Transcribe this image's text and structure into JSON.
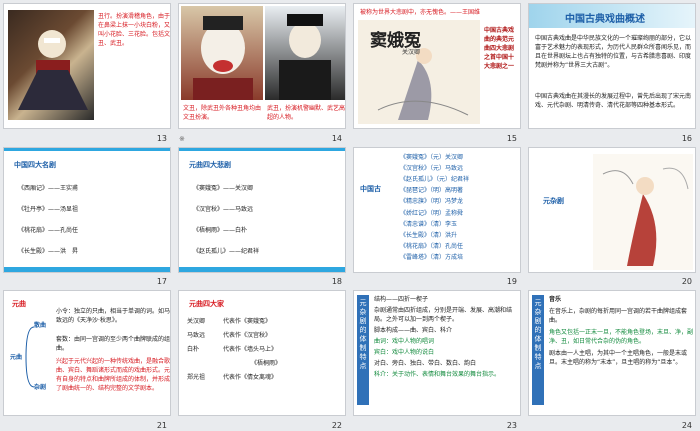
{
  "slides": [
    {
      "number": "13",
      "caption": "丑行。扮演滑稽角色，由于在鼻梁上抹一小块白粉，又叫小花脸、三花脸。包括文丑、武丑。"
    },
    {
      "number": "14",
      "transition_icon": "※",
      "caption_left": "文丑，除武丑外各种丑角均由文丑扮演。",
      "caption_right": "武丑，扮演机警幽默、武艺高超的人物。"
    },
    {
      "number": "15",
      "top_line": "被称为世界大悲剧中，亦无愧色。——王国维",
      "title": "窦娥冤",
      "subtitle": "关汉卿",
      "side_text": "中国古典戏曲的典范元曲四大悲剧之首中国十大悲剧之一"
    },
    {
      "number": "16",
      "title": "中国古典戏曲概述",
      "para1": "中国古典戏曲是中华民族文化的一个璀璨绚丽的部分，它以富于艺术魅力的表现形式，为历代人民群众所喜闻乐见，而且在世界剧坛上也占有独特的位置，与古希腊悲喜剧、印度梵剧并称为“世界三大古剧”。",
      "para2": "中国古典戏曲在其漫长的发展过程中，曾先后出现了宋元南戏、元代杂剧、明清传奇、清代花部等四种基本形式。"
    },
    {
      "number": "17",
      "heading": "中国四大名剧",
      "items": [
        "《西厢记》——王实甫",
        "《牡丹亭》——汤显祖",
        "《桃花扇》——孔尚任",
        "《长生殿》——洪　昇"
      ]
    },
    {
      "number": "18",
      "heading": "元曲四大悲剧",
      "items": [
        "《窦娥冤》——关汉卿",
        "《汉宫秋》——马致远",
        "《梧桐雨》——白朴",
        "《赵氏孤儿》——纪君祥"
      ]
    },
    {
      "number": "19",
      "side_label": "中国古",
      "items": [
        "《窦娥冤》（元）关汉卿",
        "《汉宫秋》（元）马致远",
        "《赵氏孤儿》（元）纪君祥",
        "《琵琶记》（明）高明著",
        "《精忠旗》（明）冯梦龙",
        "《娇红记》（明）孟称舜",
        "《清忠谱》（清）李玉",
        "《长生殿》（清）洪升",
        "《桃花扇》（清）孔尚任",
        "《雷峰塔》（清）方成培"
      ]
    },
    {
      "number": "20",
      "label": "元杂剧"
    },
    {
      "number": "21",
      "heading": "元曲",
      "root": "元曲",
      "branch1": "散曲",
      "branch2": "杂剧",
      "leaf1": "小令：独立的只曲，相当于单调的词。如马致远的《天净沙·秋思》。",
      "leaf2": "套数：由同一宫调的至少两个曲牌联成的组曲。",
      "leaf3": "兴起于元代兴起的一种传统戏曲，是融合歌曲、宾白、舞蹈诸形式而成的戏曲形式。元有自身的特点和曲牌所组成的体制，并形成了剧曲统一的、结构完整的文学剧本。"
    },
    {
      "number": "22",
      "heading": "元曲四大家",
      "rows": [
        {
          "name": "关汉卿",
          "work": "代表作《窦娥冤》"
        },
        {
          "name": "马致远",
          "work": "代表作《汉宫秋》"
        },
        {
          "name": "白朴",
          "work": "代表作《墙头马上》"
        },
        {
          "name": "",
          "work": "《梧桐雨》"
        },
        {
          "name": "郑光祖",
          "work": "代表作《倩女离魂》"
        }
      ]
    },
    {
      "number": "23",
      "vertical_label": "元杂剧的体制特点",
      "lines": [
        "结构——四折一楔子",
        "杂剧通常由四折组成，分别是开端、发展、高潮和结局。之外可以加一到两个楔子。",
        "脚本构成——曲、宾白、科介",
        "曲词：戏中人物的唱词",
        "宾白：戏中人物的说白",
        "对白、旁白、独白、带白、数白、韵白",
        "科介：关于动作、表情和舞台效果的舞台指示。"
      ]
    },
    {
      "number": "24",
      "vertical_label": "元杂剧的体制特点",
      "heading": "音乐",
      "para1": "在音乐上，杂剧的每折用同一宫调的若干曲牌组成套曲。",
      "para2": "角色又包括一正末一旦，不能角色登场，末旦、净，副净、丑，如日常代合杂的伪的角色。",
      "para3": "剧本由一人主唱，为其中一个主唱角色，一般是末或旦。末主唱的称为“末本”，旦主唱的称为“旦本”。"
    }
  ]
}
